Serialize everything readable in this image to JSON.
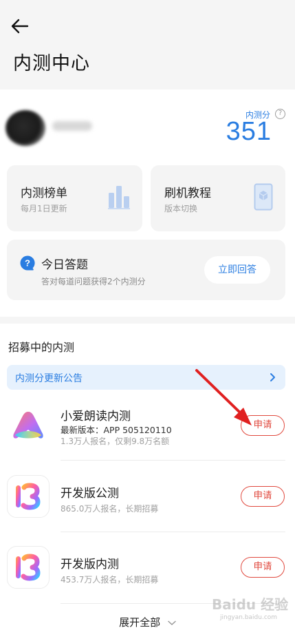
{
  "header": {
    "title": "内测中心",
    "back_icon": "back-arrow-icon"
  },
  "profile": {
    "score_label": "内测分",
    "score_value": "351",
    "help_icon": "help-icon"
  },
  "cards": {
    "ranking": {
      "title": "内测榜单",
      "subtitle": "每月1日更新",
      "icon": "bar-chart-icon"
    },
    "flash": {
      "title": "刷机教程",
      "subtitle": "版本切换",
      "icon": "phone-icon"
    },
    "quiz": {
      "title": "今日答题",
      "subtitle": "答对每道问题获得2个内测分",
      "button": "立即回答",
      "icon": "question-bubble-icon"
    }
  },
  "section": {
    "title": "招募中的内测"
  },
  "notice": {
    "text": "内测分更新公告",
    "icon": "chevron-right-icon"
  },
  "programs": [
    {
      "title": "小爱朗读内测",
      "version": "最新版本：APP 505120110",
      "meta": "1.3万人报名，仅剩9.8万名额",
      "button": "申请",
      "icon": "xiaoai-logo-icon"
    },
    {
      "title": "开发版公测",
      "meta": "865.0万人报名，长期招募",
      "button": "申请",
      "icon": "miui13-logo-icon"
    },
    {
      "title": "开发版内测",
      "meta": "453.7万人报名，长期招募",
      "button": "申请",
      "icon": "miui13-logo-icon"
    }
  ],
  "footer": {
    "expand": "展开全部",
    "icon": "chevron-down-icon"
  },
  "watermark": {
    "text": "Baidu 经验",
    "sub": "jingyan.baidu.com"
  },
  "colors": {
    "accent": "#2a7de1",
    "danger": "#e0493e",
    "annotation_arrow": "#e02020"
  }
}
